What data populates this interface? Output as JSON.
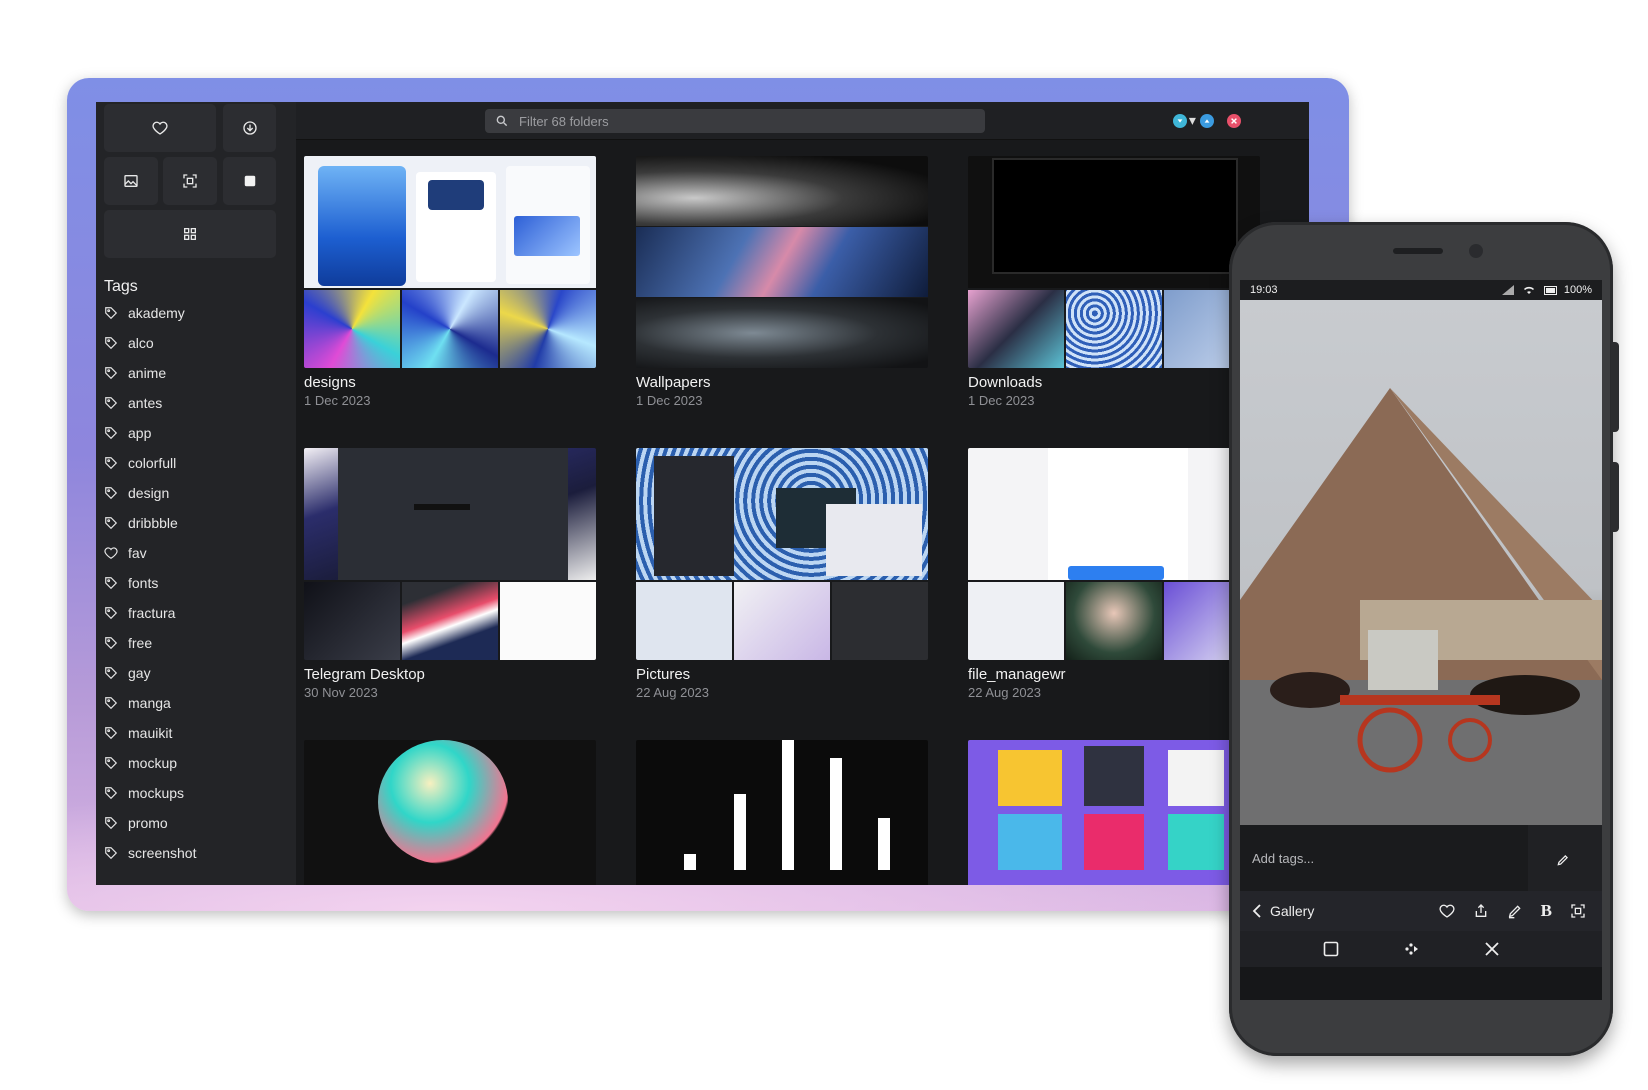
{
  "sidebar": {
    "buttons": [
      {
        "icon": "heart-icon"
      },
      {
        "icon": "download-icon"
      },
      {
        "icon": "image-icon"
      },
      {
        "icon": "screenshot-icon"
      },
      {
        "icon": "square-icon"
      },
      {
        "icon": "grid-icon"
      }
    ],
    "tags_title": "Tags",
    "tags": [
      {
        "label": "akademy",
        "icon": "tag-icon"
      },
      {
        "label": "alco",
        "icon": "tag-icon"
      },
      {
        "label": "anime",
        "icon": "tag-icon"
      },
      {
        "label": "antes",
        "icon": "tag-icon"
      },
      {
        "label": "app",
        "icon": "tag-icon"
      },
      {
        "label": "colorfull",
        "icon": "tag-icon"
      },
      {
        "label": "design",
        "icon": "tag-icon"
      },
      {
        "label": "dribbble",
        "icon": "tag-icon"
      },
      {
        "label": "fav",
        "icon": "heart-icon"
      },
      {
        "label": "fonts",
        "icon": "tag-icon"
      },
      {
        "label": "fractura",
        "icon": "tag-icon"
      },
      {
        "label": "free",
        "icon": "tag-icon"
      },
      {
        "label": "gay",
        "icon": "tag-icon"
      },
      {
        "label": "manga",
        "icon": "tag-icon"
      },
      {
        "label": "mauikit",
        "icon": "tag-icon"
      },
      {
        "label": "mockup",
        "icon": "tag-icon"
      },
      {
        "label": "mockups",
        "icon": "tag-icon"
      },
      {
        "label": "promo",
        "icon": "tag-icon"
      },
      {
        "label": "screenshot",
        "icon": "tag-icon"
      }
    ]
  },
  "topbar": {
    "search_placeholder": "Filter 68 folders",
    "menu_label": "⋮ ▾",
    "window_buttons": [
      {
        "name": "minimize",
        "color": "#3fb6d8"
      },
      {
        "name": "maximize",
        "color": "#3b9be0"
      },
      {
        "name": "close",
        "color": "#e8506a"
      }
    ]
  },
  "folders": [
    {
      "title": "designs",
      "date": "1 Dec 2023"
    },
    {
      "title": "Wallpapers",
      "date": "1 Dec 2023"
    },
    {
      "title": "Downloads",
      "date": "1 Dec 2023"
    },
    {
      "title": "Telegram Desktop",
      "date": "30 Nov 2023"
    },
    {
      "title": "Pictures",
      "date": "22 Aug 2023"
    },
    {
      "title": "file_managewr",
      "date": "22 Aug 2023"
    },
    {
      "title": "",
      "date": ""
    },
    {
      "title": "",
      "date": ""
    },
    {
      "title": "",
      "date": ""
    }
  ],
  "phone": {
    "status_time": "19:03",
    "battery": "100%",
    "tags_placeholder": "Add tags...",
    "back_label": "Gallery",
    "toolbar_icons": [
      "heart-icon",
      "share-icon",
      "edit-icon",
      "bold-icon",
      "fullscreen-icon"
    ],
    "nav_icons": [
      "square-icon",
      "move-icon",
      "close-icon"
    ]
  },
  "colors": {
    "accent_blue": "#3b9be0",
    "accent_red": "#e8506a",
    "sidebar_bg": "#232427",
    "content_bg": "#18191b"
  }
}
